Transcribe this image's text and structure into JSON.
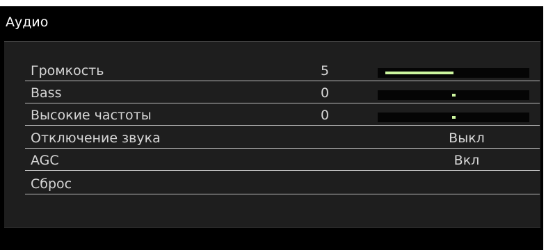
{
  "window": {
    "title": "Аудио"
  },
  "items": {
    "volume": {
      "label": "Громкость",
      "value": "5",
      "level": 0.5
    },
    "bass": {
      "label": "Bass",
      "value": "0",
      "level": 0
    },
    "treble": {
      "label": "Высокие частоты",
      "value": "0",
      "level": 0
    },
    "mute": {
      "label": "Отключение звука",
      "state": "Выкл"
    },
    "agc": {
      "label": "AGC",
      "state": "Вкл"
    },
    "reset": {
      "label": "Сброс"
    }
  },
  "colors": {
    "background": "#000000",
    "panel": "#1e1e1e",
    "text": "#d6d6d6",
    "bar_fill": "#cdf7a0",
    "divider": "#bdbdbd"
  }
}
